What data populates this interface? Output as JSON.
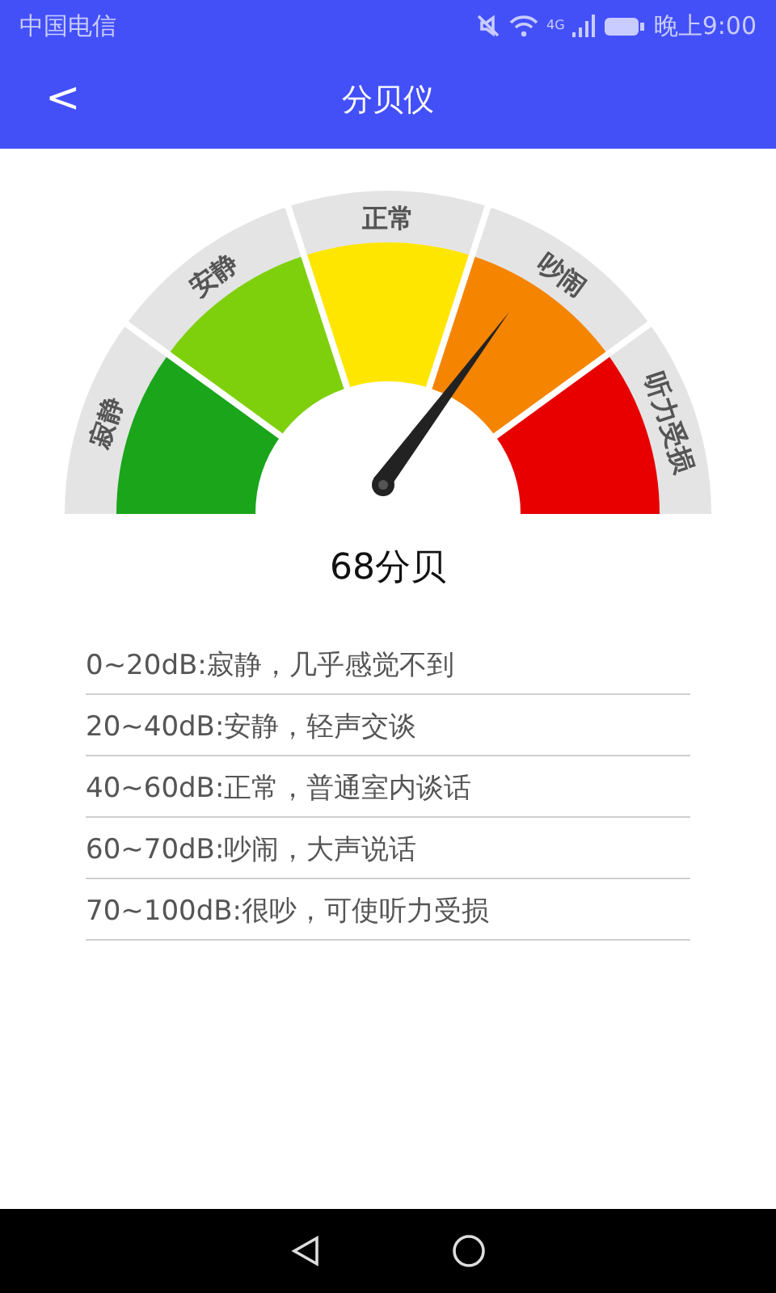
{
  "status_bar": {
    "carrier": "中国电信",
    "network": "4G",
    "time": "晚上9:00"
  },
  "header": {
    "back": "<",
    "title": "分贝仪"
  },
  "gauge": {
    "segments": [
      {
        "label": "寂静",
        "color": "#1aa51a"
      },
      {
        "label": "安静",
        "color": "#7ed00c"
      },
      {
        "label": "正常",
        "color": "#ffe600"
      },
      {
        "label": "吵闹",
        "color": "#f58400"
      },
      {
        "label": "听力受损",
        "color": "#e80000"
      }
    ]
  },
  "reading": "68分贝",
  "levels": [
    "0~20dB:寂静，几乎感觉不到",
    "20~40dB:安静，轻声交谈",
    "40~60dB:正常，普通室内谈话",
    "60~70dB:吵闹，大声说话",
    "70~100dB:很吵，可使听力受损"
  ]
}
